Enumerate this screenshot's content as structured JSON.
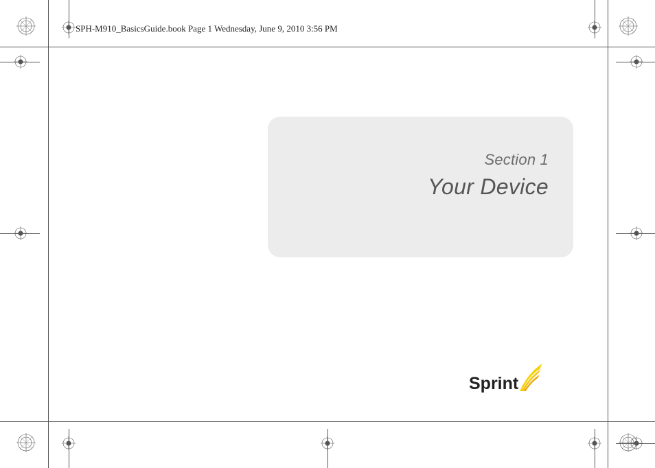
{
  "header": {
    "running_text": "SPH-M910_BasicsGuide.book  Page 1  Wednesday, June 9, 2010  3:56 PM"
  },
  "card": {
    "section_label": "Section 1",
    "section_title": "Your Device"
  },
  "logo": {
    "brand_text": "Sprint"
  }
}
